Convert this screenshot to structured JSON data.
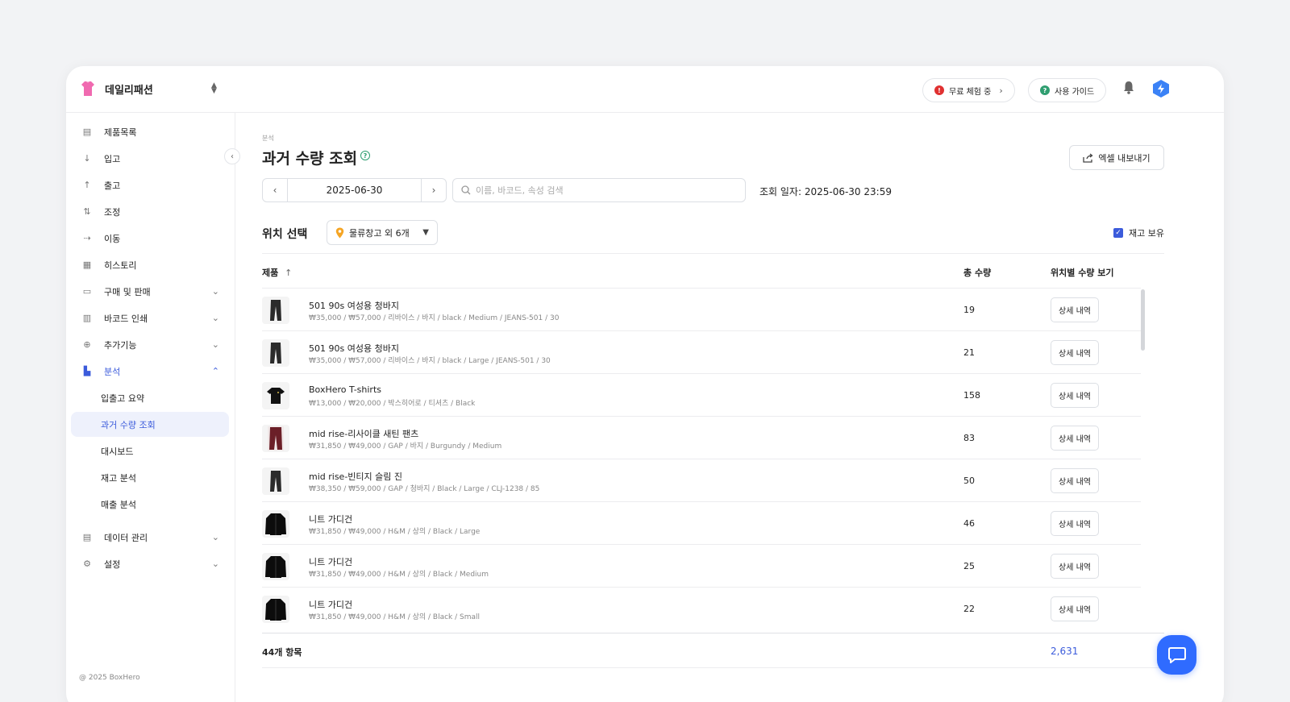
{
  "header": {
    "brand_name": "데일리패션",
    "trial_label": "무료 체험 중",
    "guide_label": "사용 가이드",
    "colors": {
      "accent": "#3b5bdb",
      "trial_dot": "#e03131",
      "guide_dot": "#2f9e70"
    }
  },
  "sidebar": {
    "items": [
      {
        "label": "제품목록",
        "icon": "box-icon"
      },
      {
        "label": "입고",
        "icon": "arrow-down-icon"
      },
      {
        "label": "출고",
        "icon": "arrow-up-icon"
      },
      {
        "label": "조정",
        "icon": "adjust-icon"
      },
      {
        "label": "이동",
        "icon": "move-icon"
      },
      {
        "label": "히스토리",
        "icon": "history-icon"
      },
      {
        "label": "구매 및 판매",
        "icon": "receipt-icon"
      },
      {
        "label": "바코드 인쇄",
        "icon": "barcode-icon"
      },
      {
        "label": "추가기능",
        "icon": "plus-circle-icon"
      },
      {
        "label": "분석",
        "icon": "chart-icon"
      },
      {
        "label": "데이터 관리",
        "icon": "database-icon"
      },
      {
        "label": "설정",
        "icon": "gear-icon"
      }
    ],
    "analysis_sub": [
      {
        "label": "입출고 요약"
      },
      {
        "label": "과거 수량 조회"
      },
      {
        "label": "대시보드"
      },
      {
        "label": "재고 분석"
      },
      {
        "label": "매출 분석"
      }
    ],
    "copyright": "@ 2025 BoxHero"
  },
  "main": {
    "breadcrumb": "분석",
    "title": "과거 수량 조회",
    "export_label": "엑셀 내보내기",
    "date": "2025-06-30",
    "search_placeholder": "이름, 바코드, 속성 검색",
    "query_date": "조회 일자: 2025-06-30 23:59",
    "location_label": "위치 선택",
    "location_value": "물류창고 외 6개",
    "in_stock_label": "재고 보유",
    "columns": {
      "product": "제품",
      "total": "총 수량",
      "by_location": "위치별 수량 보기"
    },
    "detail_label": "상세 내역",
    "rows": [
      {
        "name": "501 90s 여성용 청바지",
        "meta": "₩35,000 / ₩57,000 / 리바이스 / 바지 / black / Medium / JEANS-501 / 30",
        "qty": "19",
        "thumb": "jeans"
      },
      {
        "name": "501 90s 여성용 청바지",
        "meta": "₩35,000 / ₩57,000 / 리바이스 / 바지 / black / Large / JEANS-501 / 30",
        "qty": "21",
        "thumb": "jeans"
      },
      {
        "name": "BoxHero T-shirts",
        "meta": "₩13,000 / ₩20,000 / 박스히어로 / 티셔츠 / Black",
        "qty": "158",
        "thumb": "tshirt"
      },
      {
        "name": "mid rise-리사이클 새틴 팬츠",
        "meta": "₩31,850 / ₩49,000 / GAP / 바지 / Burgundy / Medium",
        "qty": "83",
        "thumb": "satin"
      },
      {
        "name": "mid rise-빈티지 슬림 진",
        "meta": "₩38,350 / ₩59,000 / GAP / 청바지 / Black / Large / CLJ-1238 / 85",
        "qty": "50",
        "thumb": "jeans"
      },
      {
        "name": "니트 가디건",
        "meta": "₩31,850 / ₩49,000 / H&M / 상의 / Black / Large",
        "qty": "46",
        "thumb": "cardigan"
      },
      {
        "name": "니트 가디건",
        "meta": "₩31,850 / ₩49,000 / H&M / 상의 / Black / Medium",
        "qty": "25",
        "thumb": "cardigan"
      },
      {
        "name": "니트 가디건",
        "meta": "₩31,850 / ₩49,000 / H&M / 상의 / Black / Small",
        "qty": "22",
        "thumb": "cardigan"
      }
    ],
    "footer_count": "44개 항목",
    "footer_total": "2,631"
  }
}
